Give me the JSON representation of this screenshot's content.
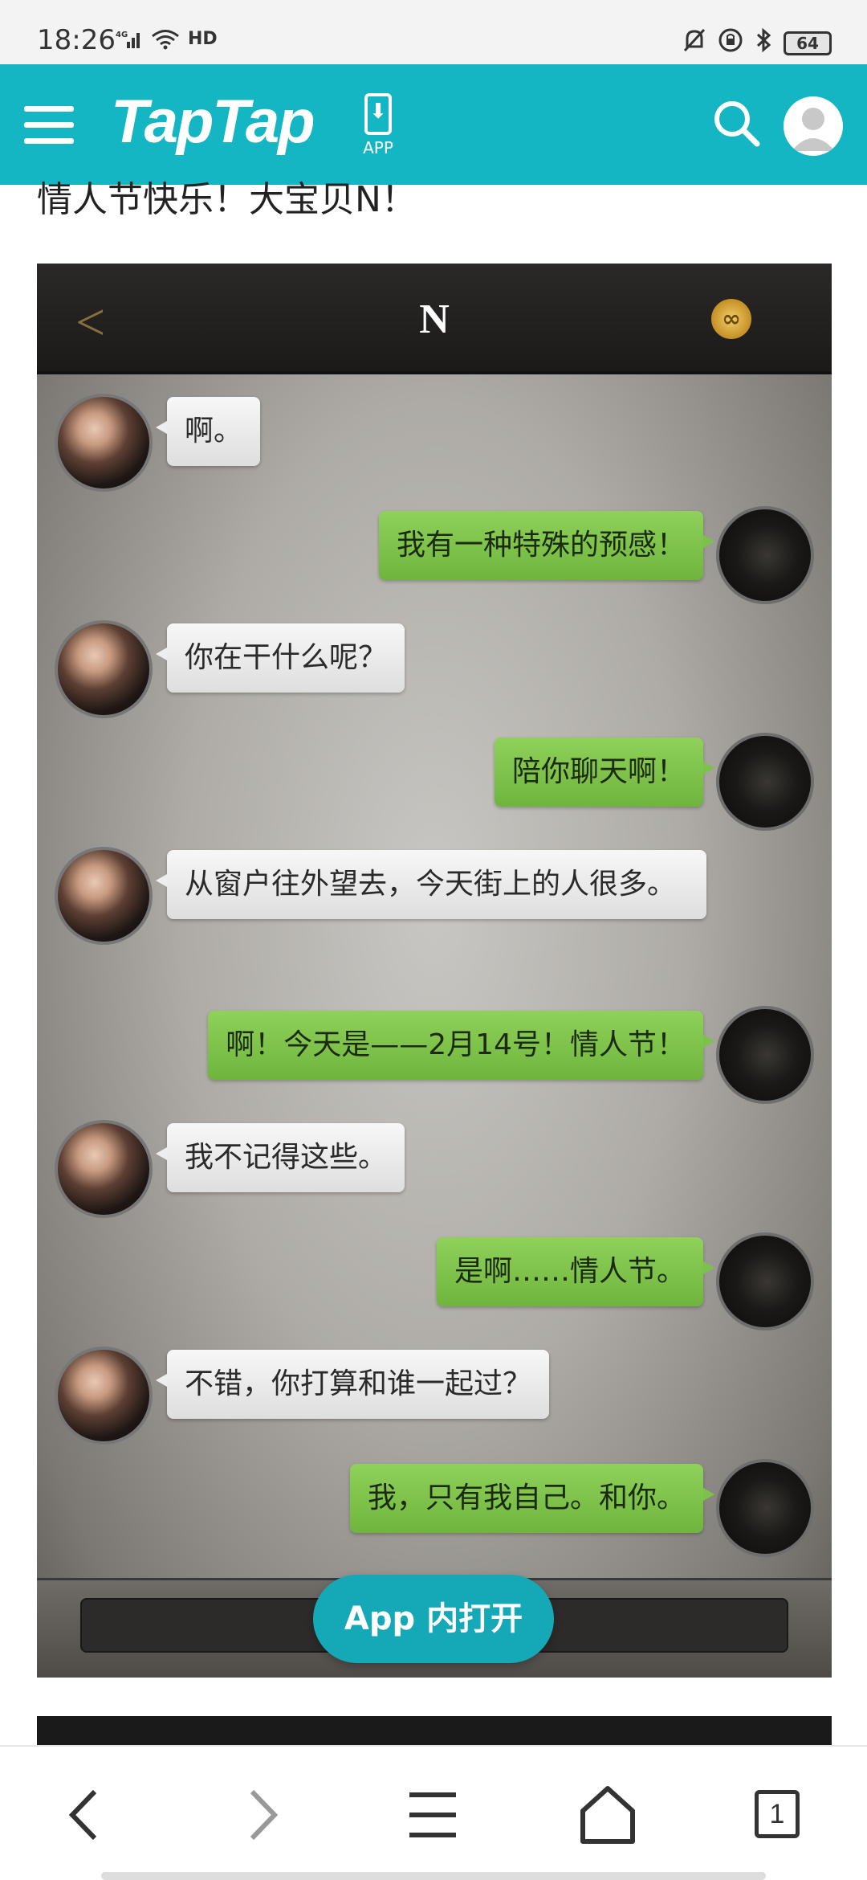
{
  "status_bar": {
    "time": "18:26",
    "network": "4G",
    "hd": "HD",
    "battery": "64",
    "icons": [
      "signal-icon",
      "wifi-icon",
      "hd-icon",
      "mute-bell-icon",
      "rotation-lock-icon",
      "bluetooth-icon",
      "battery-icon"
    ]
  },
  "top_bar": {
    "logo": "TapTap",
    "app_label": "APP",
    "accent": "#15b6c3"
  },
  "post": {
    "heading": "情人节快乐！大宝贝N！"
  },
  "chat": {
    "title": "N",
    "badge": "∞",
    "messages": [
      {
        "side": "left",
        "text": "啊。"
      },
      {
        "side": "right",
        "text": "我有一种特殊的预感！"
      },
      {
        "side": "left",
        "text": "你在干什么呢？"
      },
      {
        "side": "right",
        "text": "陪你聊天啊！"
      },
      {
        "side": "left",
        "text": "从窗户往外望去，今天街上的人很多。"
      },
      {
        "side": "right",
        "text": "啊！今天是——2月14号！情人节！"
      },
      {
        "side": "left",
        "text": "我不记得这些。"
      },
      {
        "side": "right",
        "text": "是啊……情人节。"
      },
      {
        "side": "left",
        "text": "不错，你打算和谁一起过？"
      },
      {
        "side": "right",
        "text": "我，只有我自己。和你。"
      }
    ]
  },
  "open_in_app": {
    "label": "App 内打开"
  },
  "bottom_nav": {
    "tab_count": "1",
    "icons": [
      "back-icon",
      "forward-icon",
      "menu-icon",
      "home-icon",
      "tabs-icon"
    ]
  }
}
